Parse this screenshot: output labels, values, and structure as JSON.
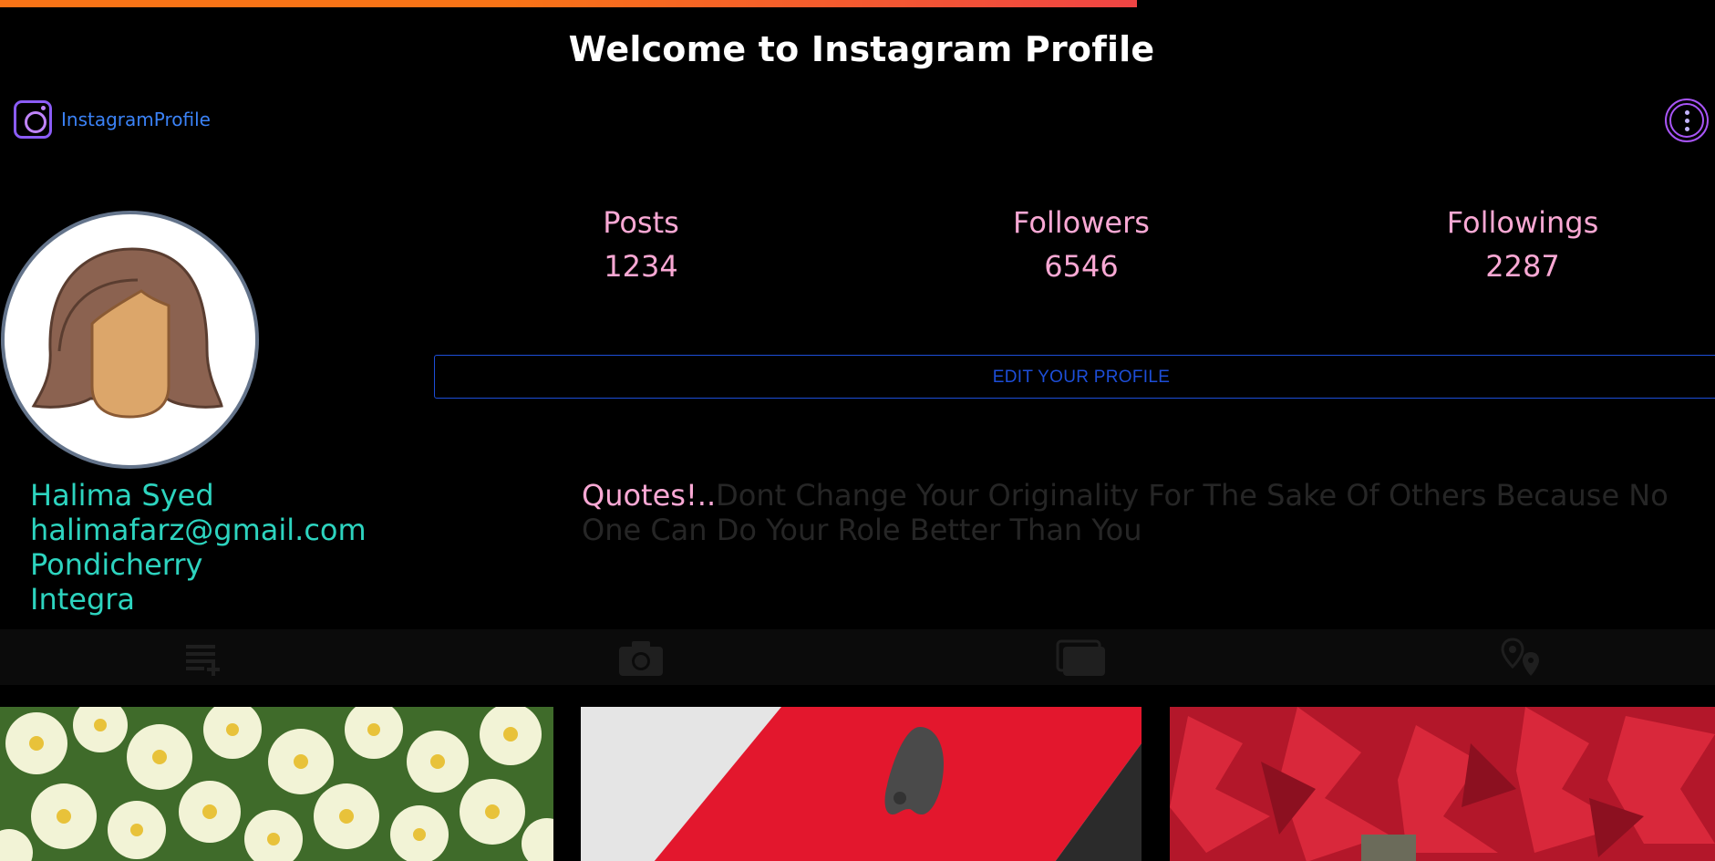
{
  "header": {
    "welcome": "Welcome to Instagram Profile",
    "brand_name": "InstagramProfile",
    "brand_icon": "instagram-icon",
    "menu_icon": "more-vertical-icon"
  },
  "stats": [
    {
      "label": "Posts",
      "value": "1234"
    },
    {
      "label": "Followers",
      "value": "6546"
    },
    {
      "label": "Followings",
      "value": "2287"
    }
  ],
  "edit_button": "EDIT YOUR PROFILE",
  "profile": {
    "name": "Halima Syed",
    "email": "halimafarz@gmail.com",
    "city": "Pondicherry",
    "company": "Integra"
  },
  "quote": {
    "label": "Quotes!..",
    "text": "Dont Change Your Originality For The Sake Of Others Because No One Can Do Your Role Better Than You"
  },
  "tabs": [
    {
      "icon": "playlist-add-icon"
    },
    {
      "icon": "camera-icon"
    },
    {
      "icon": "gallery-icon"
    },
    {
      "icon": "locations-icon"
    }
  ],
  "posts": [
    {
      "subject": "white-primrose-flowers"
    },
    {
      "subject": "red-phone-back"
    },
    {
      "subject": "red-maple-leaves"
    }
  ],
  "colors": {
    "accent_orange": "#f97316",
    "accent_red": "#ef4444",
    "stat_pink": "#f9a8d4",
    "info_teal": "#2dd4bf",
    "link_blue": "#1d4ed8",
    "brand_purple": "#a855f7"
  }
}
